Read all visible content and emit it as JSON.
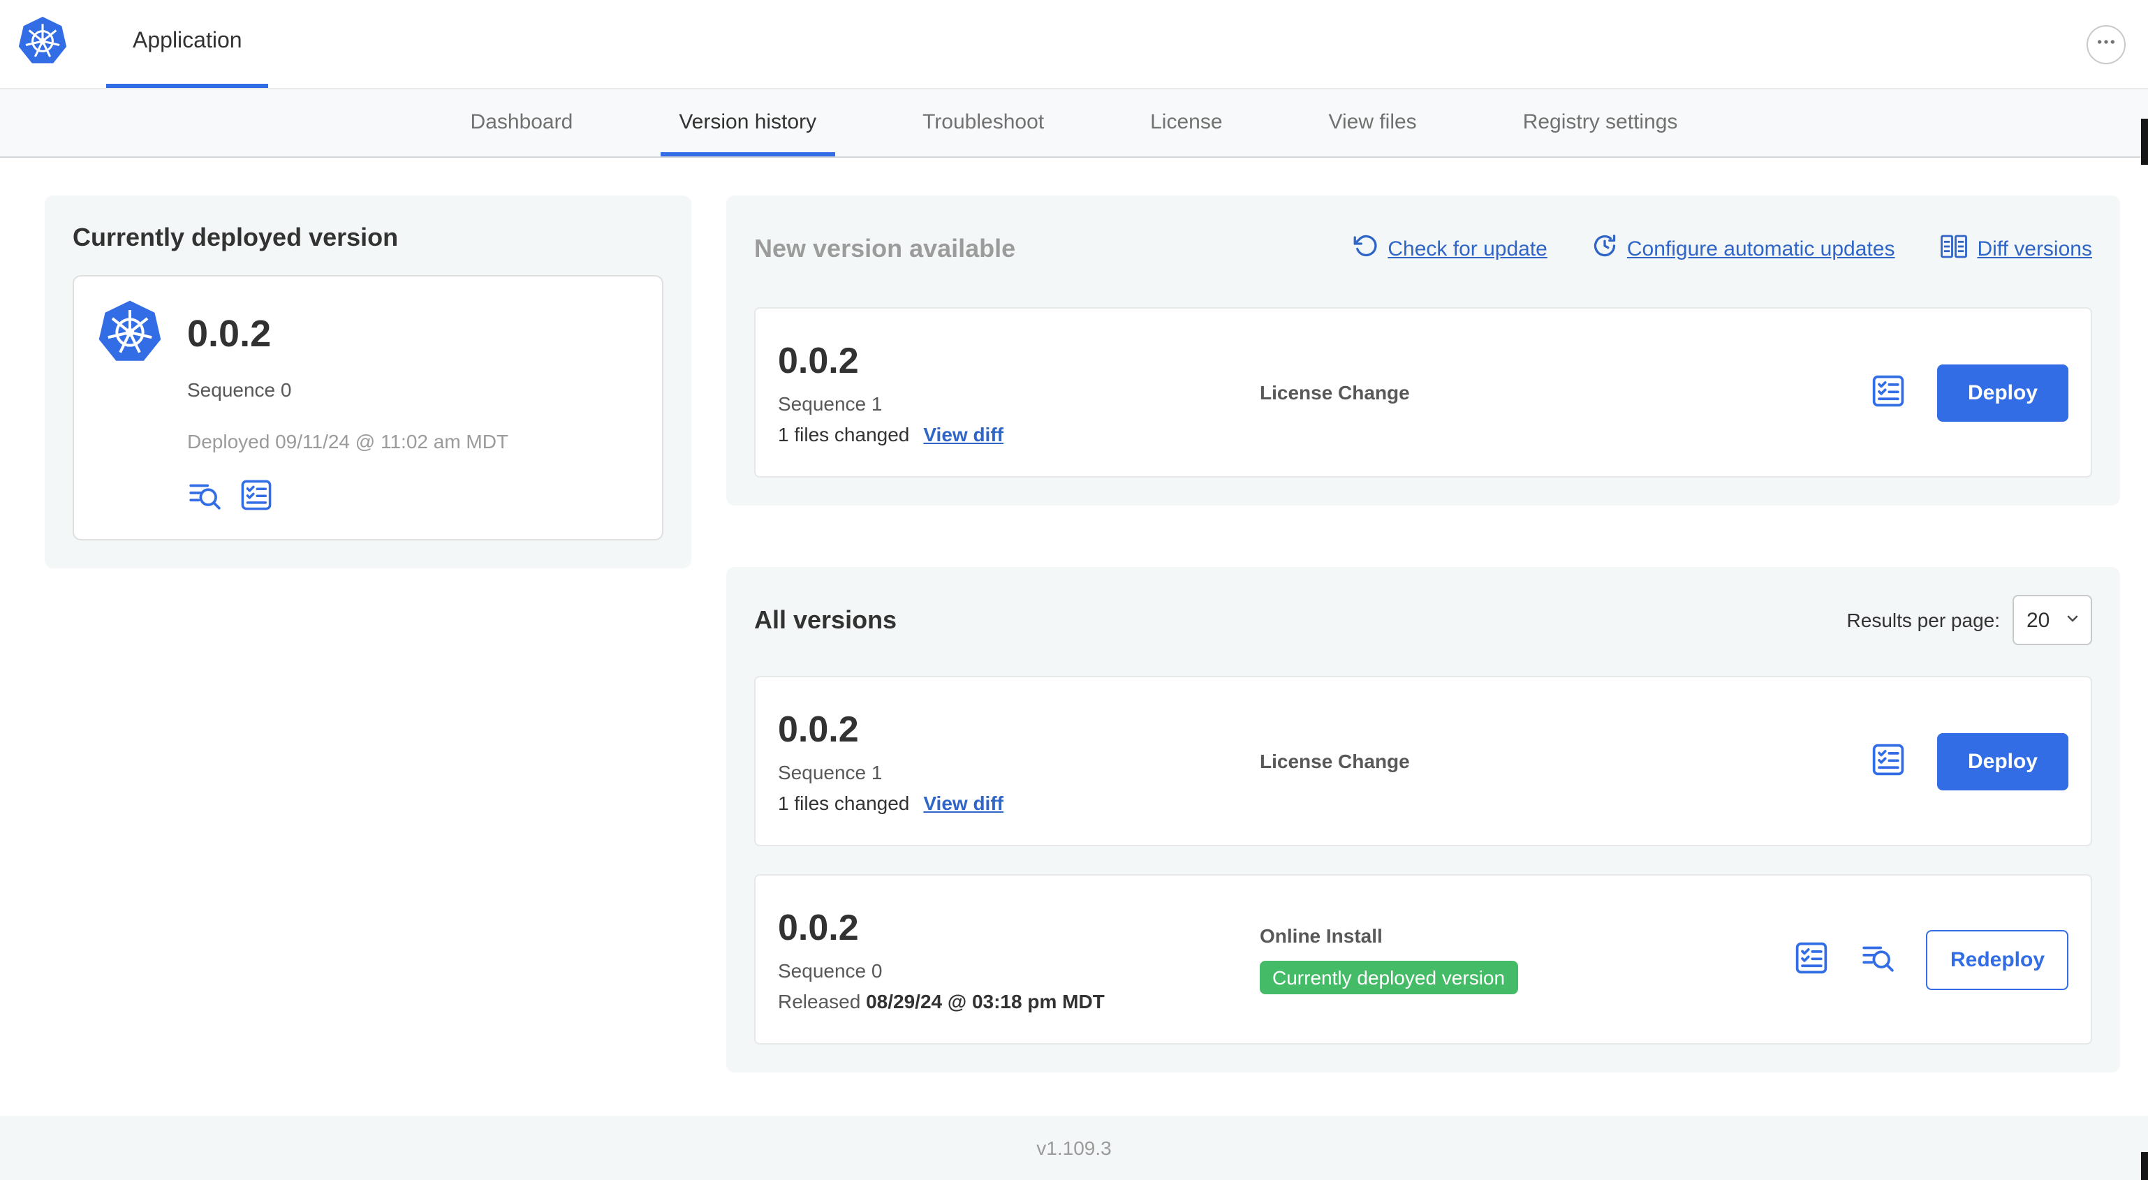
{
  "colors": {
    "accent": "#326de6",
    "link": "#3065c8",
    "badge_green": "#44bb66"
  },
  "header": {
    "app_tab": "Application"
  },
  "nav": {
    "active_tab": "Version history",
    "tabs": [
      {
        "label": "Dashboard"
      },
      {
        "label": "Version history"
      },
      {
        "label": "Troubleshoot"
      },
      {
        "label": "License"
      },
      {
        "label": "View files"
      },
      {
        "label": "Registry settings"
      }
    ]
  },
  "current_version": {
    "title": "Currently deployed version",
    "version": "0.0.2",
    "sequence": "Sequence 0",
    "deployed": "Deployed 09/11/24 @ 11:02 am MDT"
  },
  "new_version": {
    "title": "New version available",
    "check_for_update": "Check for update",
    "configure_updates": "Configure automatic updates",
    "diff_versions": "Diff versions",
    "row": {
      "version": "0.0.2",
      "sequence": "Sequence 1",
      "files_changed": "1 files changed",
      "view_diff": "View diff",
      "source": "License Change",
      "action": "Deploy"
    }
  },
  "all_versions": {
    "title": "All versions",
    "results_label": "Results per page:",
    "results_value": "20",
    "rows": [
      {
        "version": "0.0.2",
        "sequence": "Sequence 1",
        "files_changed": "1 files changed",
        "view_diff": "View diff",
        "source": "License Change",
        "action": "Deploy"
      },
      {
        "version": "0.0.2",
        "sequence": "Sequence 0",
        "released_label": "Released",
        "released_date": "08/29/24 @ 03:18 pm MDT",
        "source": "Online Install",
        "badge": "Currently deployed version",
        "action": "Redeploy"
      }
    ]
  },
  "footer": {
    "app_version": "v1.109.3"
  },
  "icons": {
    "kubernetes-logo-icon": "blue heptagon with white helm wheel",
    "more-options-icon": "horizontal ellipsis in circle",
    "refresh-icon": "counterclockwise circular arrow",
    "schedule-update-icon": "clock with circular arrow",
    "diff-versions-icon": "two side-by-side tables",
    "preflight-checks-icon": "bordered checklist with checkmarks",
    "release-notes-icon": "text lines with magnifying glass",
    "chevron-down-icon": "downward chevron"
  }
}
